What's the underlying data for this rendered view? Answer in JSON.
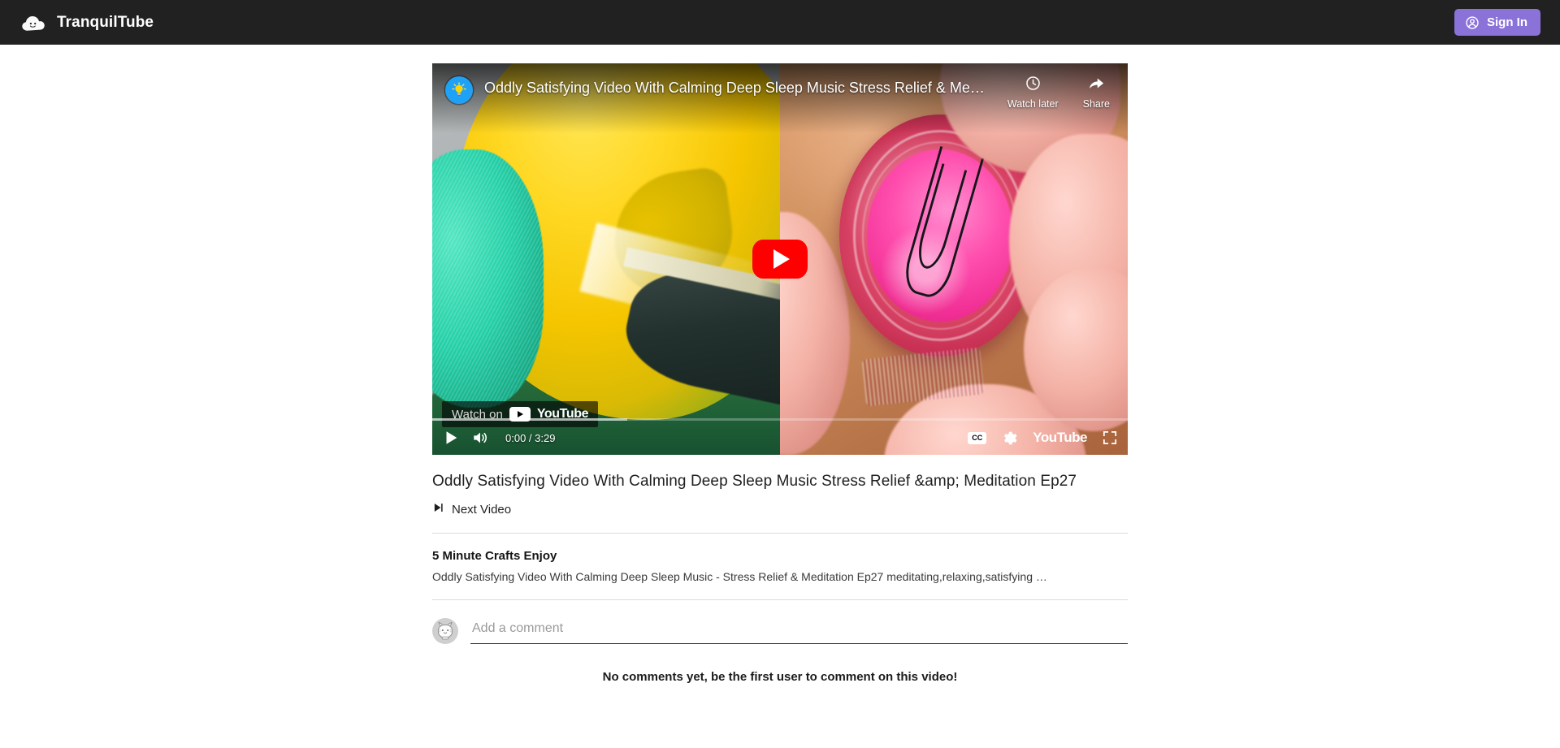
{
  "header": {
    "brand_name": "TranquilTube",
    "logo_icon": "cloud-smiley-icon",
    "signin_label": "Sign In",
    "signin_icon": "user-circle-icon",
    "accent_color": "#8a72d9",
    "background_color": "#212121"
  },
  "player": {
    "overlay_title": "Oddly Satisfying Video With Calming Deep Sleep Music Stress Relief & Medit…",
    "channel_avatar_icon": "lightbulb-icon",
    "watch_later_label": "Watch later",
    "watch_later_icon": "clock-icon",
    "share_label": "Share",
    "share_icon": "share-arrow-icon",
    "play_button_icon": "play-icon",
    "watch_on_label": "Watch on",
    "youtube_wordmark": "YouTube",
    "current_time": "0:00",
    "duration": "3:29",
    "time_display": "0:00 / 3:29",
    "progress_percent": 0,
    "buffered_percent": 28,
    "controls": {
      "play_icon": "play-icon",
      "volume_icon": "volume-icon",
      "captions_label": "CC",
      "settings_icon": "gear-icon",
      "youtube_label": "YouTube",
      "fullscreen_icon": "fullscreen-icon"
    }
  },
  "video": {
    "title": "Oddly Satisfying Video With Calming Deep Sleep Music Stress Relief &amp; Meditation Ep27",
    "next_video_label": "Next Video",
    "next_video_icon": "skip-next-icon"
  },
  "channel": {
    "name": "5 Minute Crafts Enjoy",
    "description": "Oddly Satisfying Video With Calming Deep Sleep Music - Stress Relief & Meditation Ep27 meditating,relaxing,satisfying …"
  },
  "comments": {
    "avatar_icon": "cat-avatar-icon",
    "input_placeholder": "Add a comment",
    "input_value": "",
    "empty_message": "No comments yet, be the first user to comment on this video!"
  }
}
